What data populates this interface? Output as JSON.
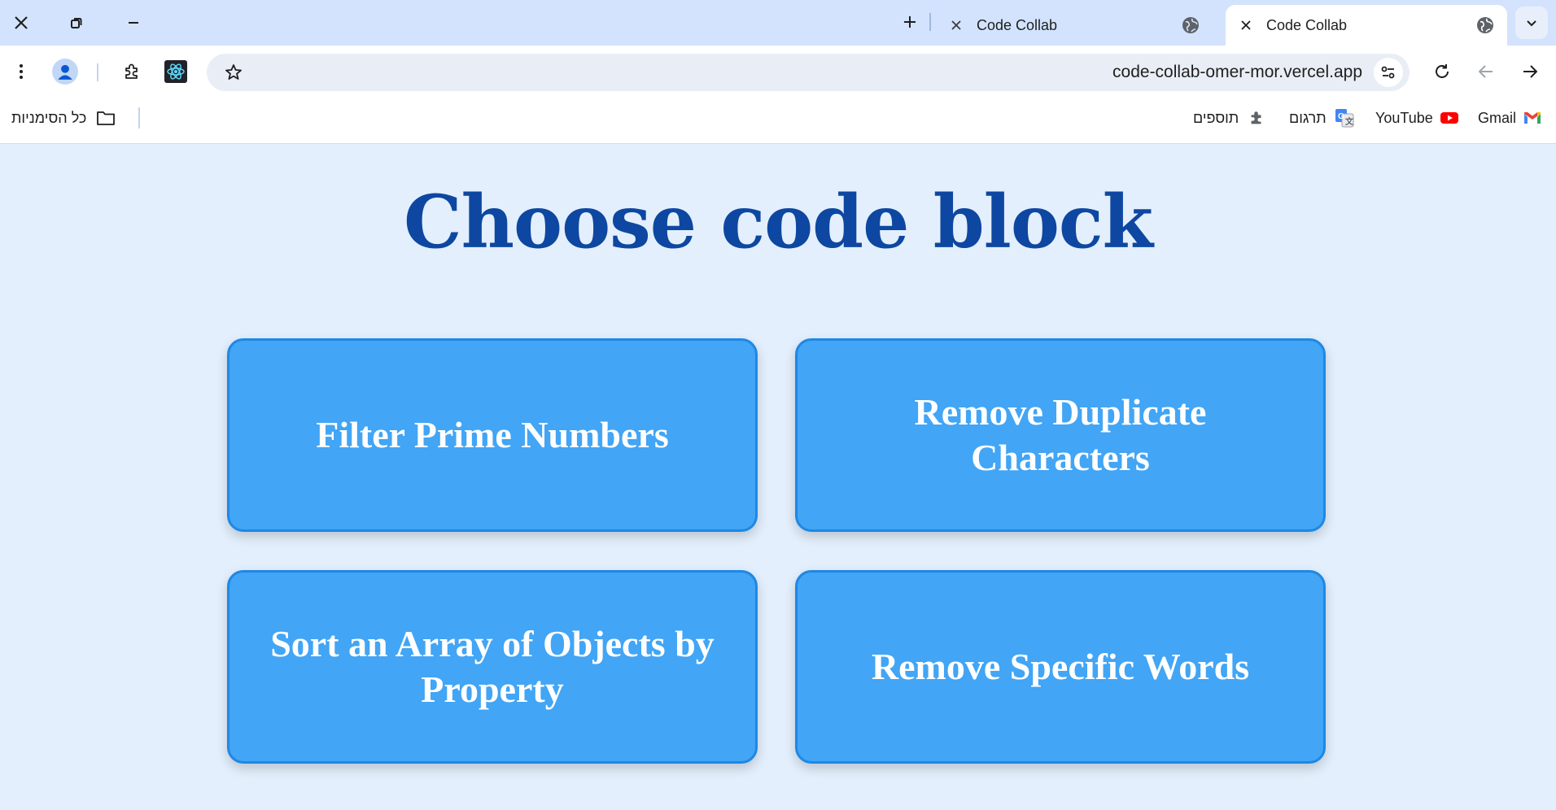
{
  "browser": {
    "tabs": [
      {
        "title": "Code Collab",
        "active": false
      },
      {
        "title": "Code Collab",
        "active": true
      }
    ],
    "url": "code-collab-omer-mor.vercel.app",
    "bookmarks": {
      "gmail": "Gmail",
      "youtube": "YouTube",
      "translate": "תרגום",
      "extensions": "תוספים",
      "all_bookmarks": "כל הסימניות"
    },
    "icons": {
      "close": "close-icon",
      "restore": "restore-icon",
      "minimize": "minimize-icon",
      "new_tab": "plus-icon",
      "favicon": "globe-icon",
      "tab_search": "chevron-down-icon",
      "menu": "kebab-menu-icon",
      "profile": "person-icon",
      "extensions": "puzzle-icon",
      "react_devtools": "react-icon",
      "bookmark": "star-icon",
      "site_settings": "tune-icon",
      "reload": "reload-icon",
      "back": "arrow-back-icon",
      "forward": "arrow-forward-icon",
      "folder": "folder-icon"
    }
  },
  "page": {
    "title": "Choose code block",
    "cards": [
      {
        "label": "Filter Prime Numbers"
      },
      {
        "label": "Remove Duplicate Characters"
      },
      {
        "label": "Sort an Array of Objects by Property"
      },
      {
        "label": "Remove Specific Words"
      }
    ]
  },
  "colors": {
    "page_background": "#e3effc",
    "title": "#0d47a1",
    "card_fill": "#42a5f5",
    "card_border": "#1e88e5",
    "tabstrip": "#d3e3fd"
  }
}
